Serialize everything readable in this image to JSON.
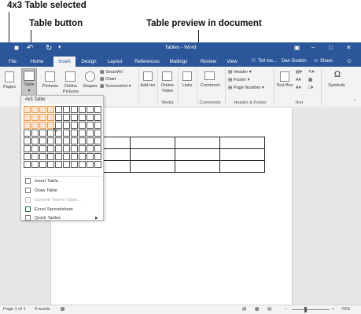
{
  "callouts": {
    "selection": "4x3 Table selected",
    "table_button": "Table button",
    "preview": "Table preview in document"
  },
  "titlebar": {
    "title": "Tables - Word",
    "bg_color": "#2b579a"
  },
  "tabs": [
    {
      "label": "File"
    },
    {
      "label": "Home"
    },
    {
      "label": "Insert"
    },
    {
      "label": "Design"
    },
    {
      "label": "Layout"
    },
    {
      "label": "References"
    },
    {
      "label": "Mailings"
    },
    {
      "label": "Review"
    },
    {
      "label": "View"
    }
  ],
  "tell_me": "Tell me...",
  "user_name": "Dan Gookin",
  "share_label": "Share",
  "ribbon": {
    "pages": "Pages",
    "table": "Table",
    "pictures": "Pictures",
    "online_pictures": "Online Pictures",
    "shapes": "Shapes",
    "smartart": "SmartArt",
    "chart": "Chart",
    "screenshot": "Screenshot",
    "addins": "Add-ins",
    "online_video": "Online Video",
    "links": "Links",
    "comment": "Comment",
    "header": "Header",
    "footer": "Footer",
    "page_number": "Page Number",
    "text_box": "Text Box",
    "symbols": "Symbols",
    "groups": {
      "media": "Media",
      "comments": "Comments",
      "header_footer": "Header & Footer",
      "text": "Text"
    }
  },
  "dropdown": {
    "header": "4x3 Table",
    "grid": {
      "cols": 10,
      "rows": 8,
      "selected_cols": 4,
      "selected_rows": 3
    },
    "items": [
      {
        "label": "Insert Table...",
        "disabled": false
      },
      {
        "label": "Draw Table",
        "disabled": false
      },
      {
        "label": "Convert Text to Table...",
        "disabled": true
      },
      {
        "label": "Excel Spreadsheet",
        "disabled": false
      },
      {
        "label": "Quick Tables",
        "disabled": false
      }
    ]
  },
  "doc_table": {
    "cols": 4,
    "rows": 3
  },
  "statusbar": {
    "page": "Page 1 of 1",
    "words": "0 words",
    "zoom": "70%"
  }
}
